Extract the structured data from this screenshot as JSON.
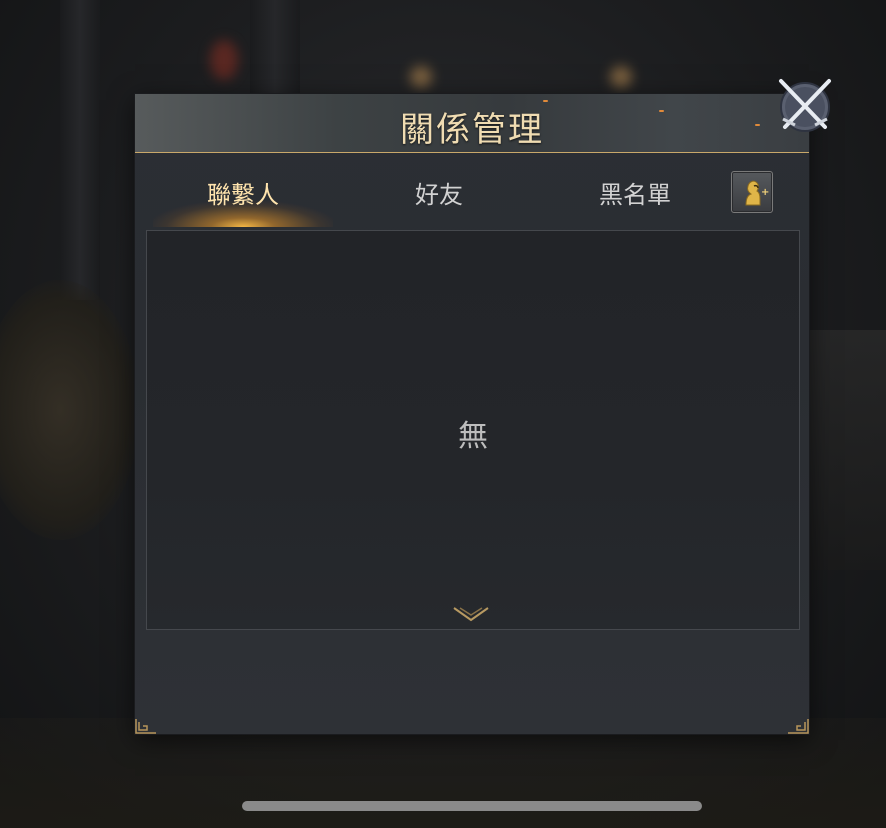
{
  "dialog": {
    "title": "關係管理"
  },
  "tabs": [
    {
      "label": "聯繫人",
      "active": true
    },
    {
      "label": "好友",
      "active": false
    },
    {
      "label": "黑名單",
      "active": false
    }
  ],
  "content": {
    "empty_text": "無"
  },
  "icons": {
    "close": "crossed-swords-close-icon",
    "add_friend": "add-friend-icon",
    "scroll_down": "chevron-down-icon"
  },
  "colors": {
    "accent_gold": "#f0dcb2",
    "active_tab": "#ffe4ad",
    "header_line": "#c9a86a"
  }
}
